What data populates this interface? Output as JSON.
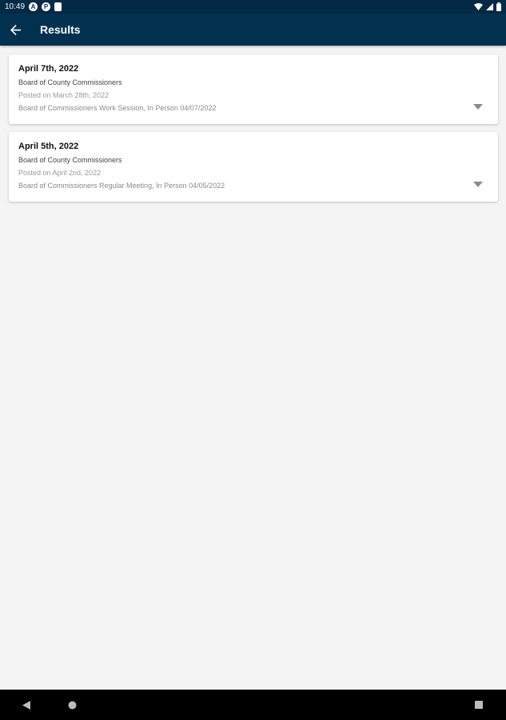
{
  "status_bar": {
    "time": "10:49",
    "icons": [
      "notification-a-icon",
      "notification-p-icon",
      "clipboard-icon"
    ],
    "right_icons": [
      "wifi-icon",
      "signal-icon",
      "battery-icon"
    ]
  },
  "app_bar": {
    "title": "Results",
    "back_icon": "arrow-back-icon",
    "color": "#02314f"
  },
  "results": [
    {
      "date": "April 7th, 2022",
      "body": "Board of County Commissioners",
      "posted": "Posted on March 28th, 2022",
      "description": "Board of Commissioners Work Session, In Person 04/07/2022"
    },
    {
      "date": "April 5th, 2022",
      "body": "Board of County Commissioners",
      "posted": "Posted on April 2nd, 2022",
      "description": "Board of Commissioners Regular Meeting, In Person 04/05/2022"
    }
  ],
  "nav_bar": {
    "icons": [
      "back-triangle-icon",
      "home-circle-icon",
      "recents-square-icon"
    ]
  }
}
